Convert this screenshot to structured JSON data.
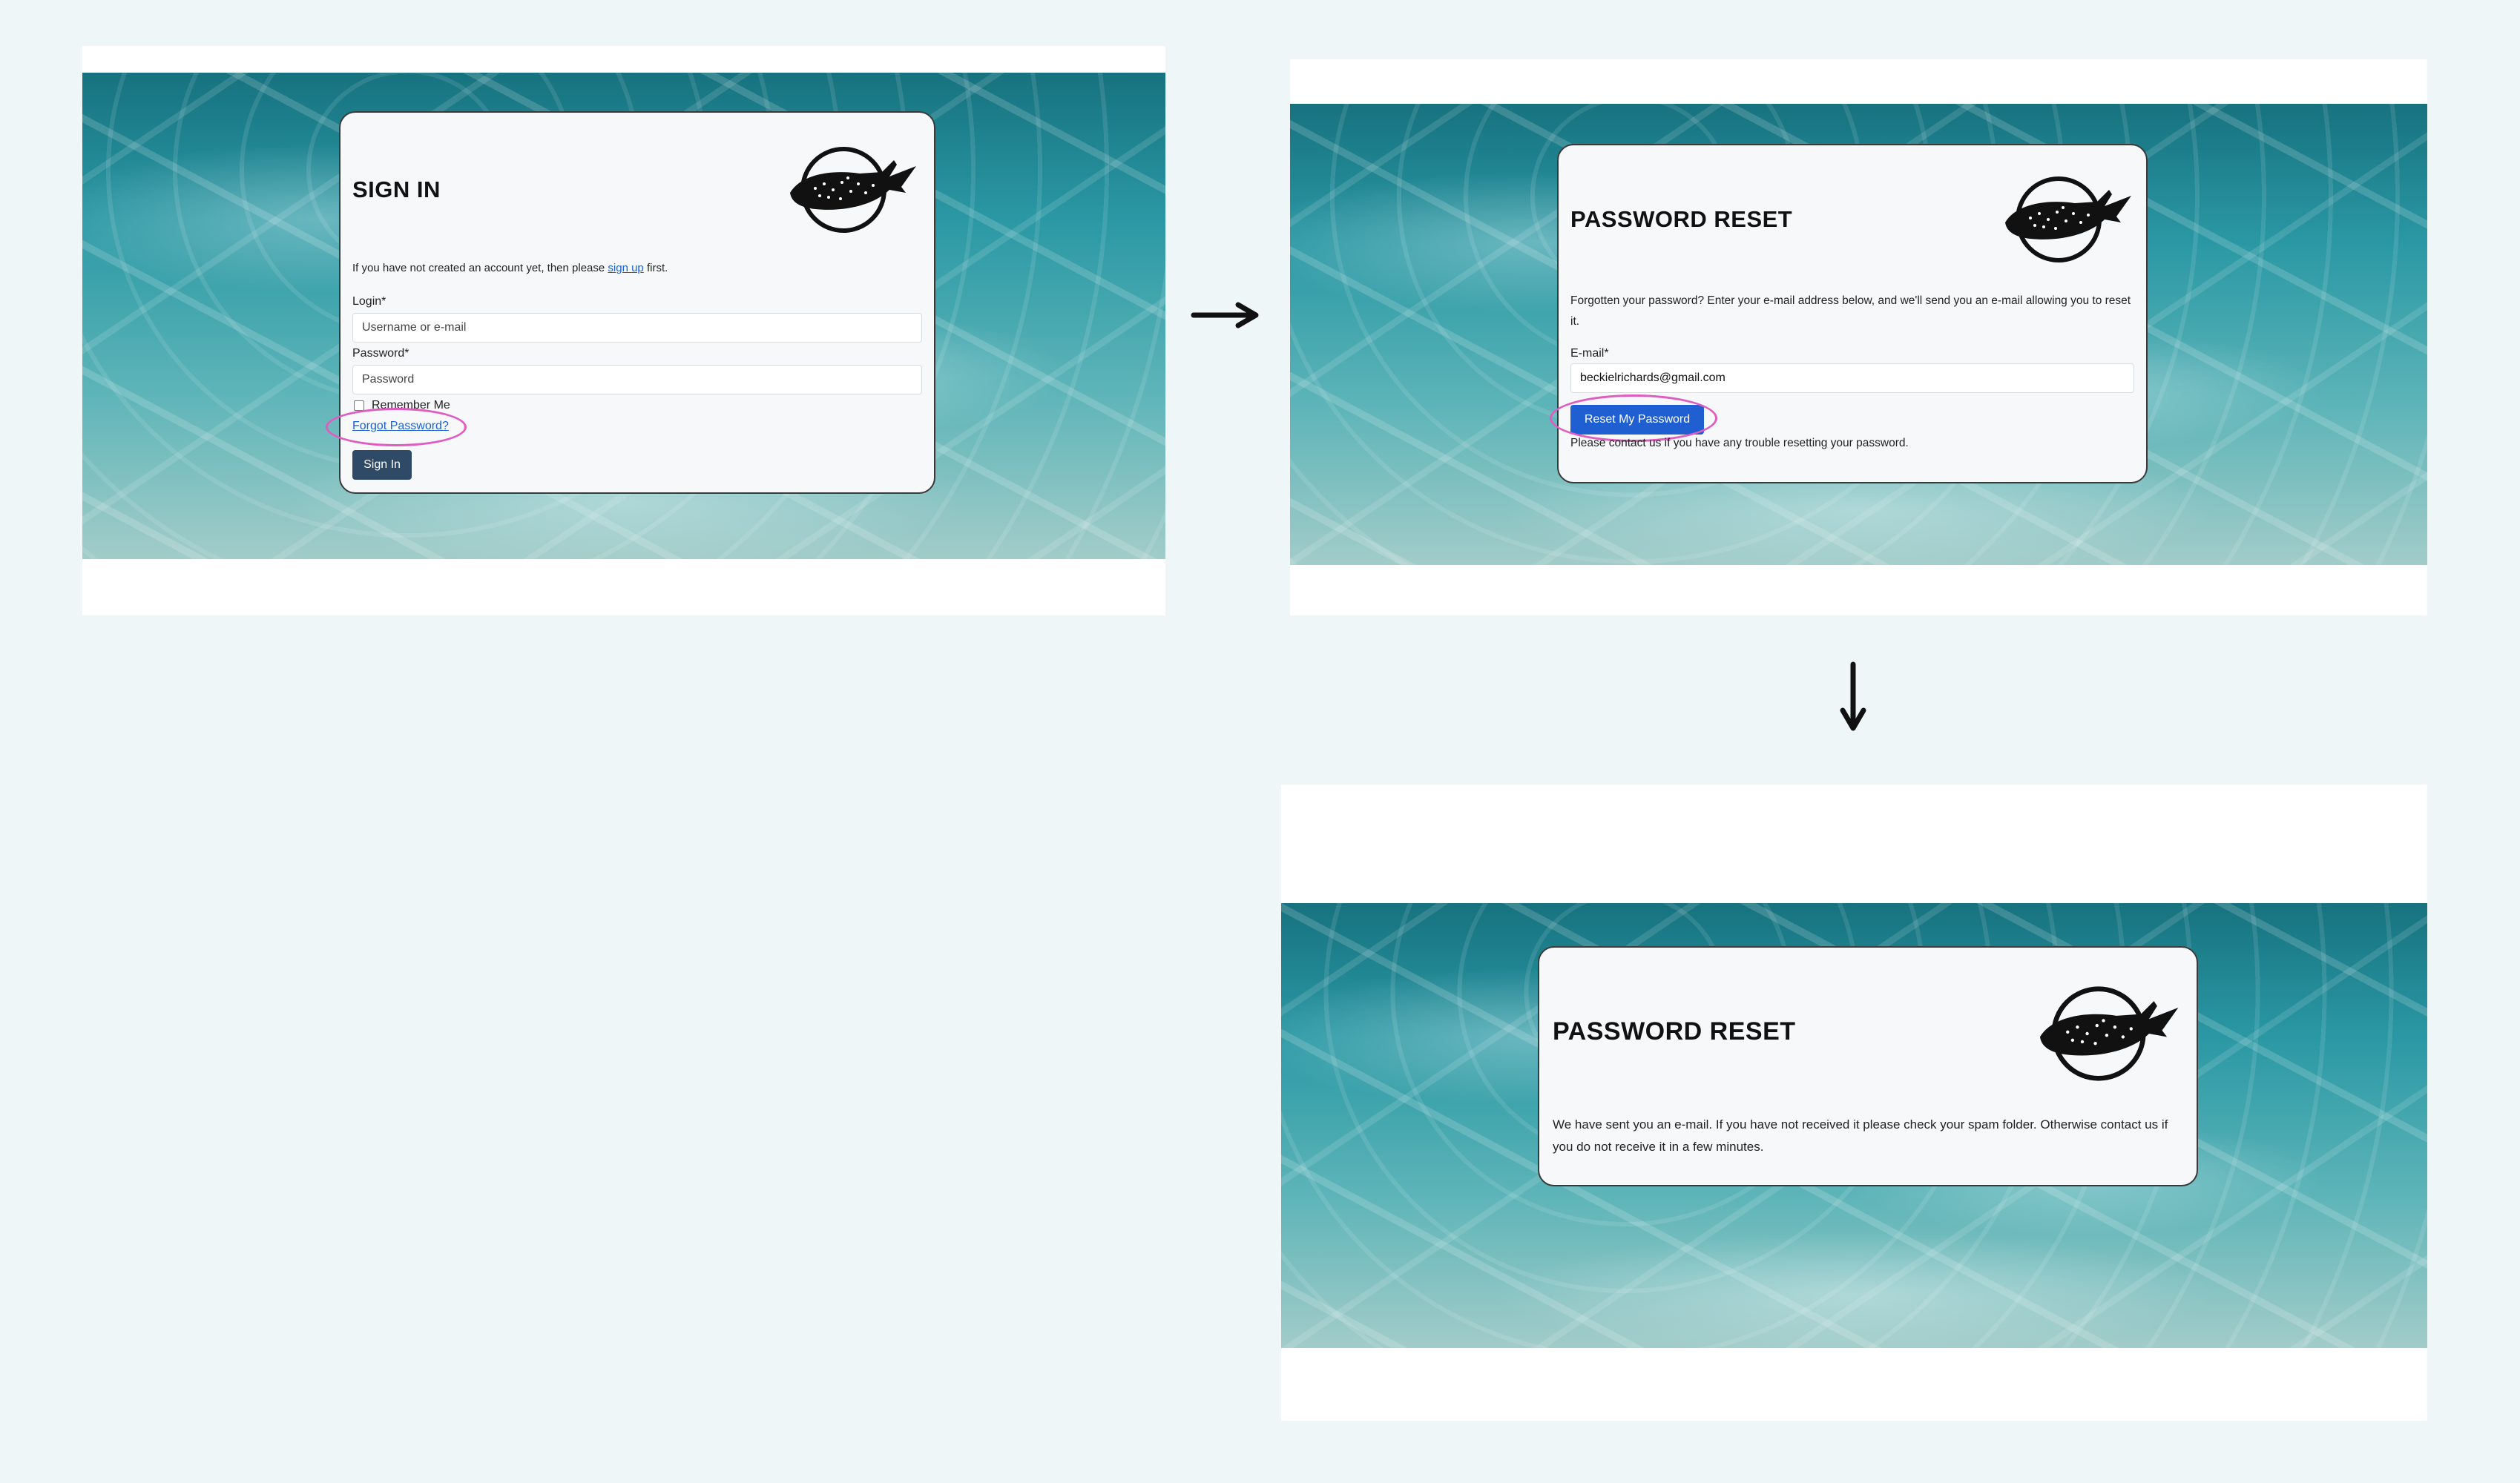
{
  "signin": {
    "title": "SIGN IN",
    "intro_prefix": "If you have not created an account yet, then please ",
    "signup_link": "sign up",
    "intro_suffix": " first.",
    "login_label": "Login*",
    "login_placeholder": "Username or e-mail",
    "password_label": "Password*",
    "password_placeholder": "Password",
    "remember_label": "Remember Me",
    "forgot_link": "Forgot Password?",
    "signin_button": "Sign In"
  },
  "reset": {
    "title": "PASSWORD RESET",
    "instructions": "Forgotten your password? Enter your e-mail address below, and we'll send you an e-mail allowing you to reset it.",
    "email_label": "E-mail*",
    "email_value": "beckielrichards@gmail.com",
    "reset_button": "Reset My Password",
    "help_text": "Please contact us if you have any trouble resetting your password."
  },
  "confirm": {
    "title": "PASSWORD RESET",
    "message": "We have sent you an e-mail. If you have not received it please check your spam folder. Otherwise contact us if you do not receive it in a few minutes."
  },
  "flow_arrows": [
    "right-arrow-icon",
    "down-arrow-icon"
  ],
  "icons": {
    "logo": "whale-shark-logo-icon"
  },
  "colors": {
    "page_bg": "#eff6f7",
    "signin_button": "#2e4a66",
    "reset_button": "#1f5fd1",
    "highlight_ring": "#e05cc0",
    "link": "#1a62d6"
  }
}
